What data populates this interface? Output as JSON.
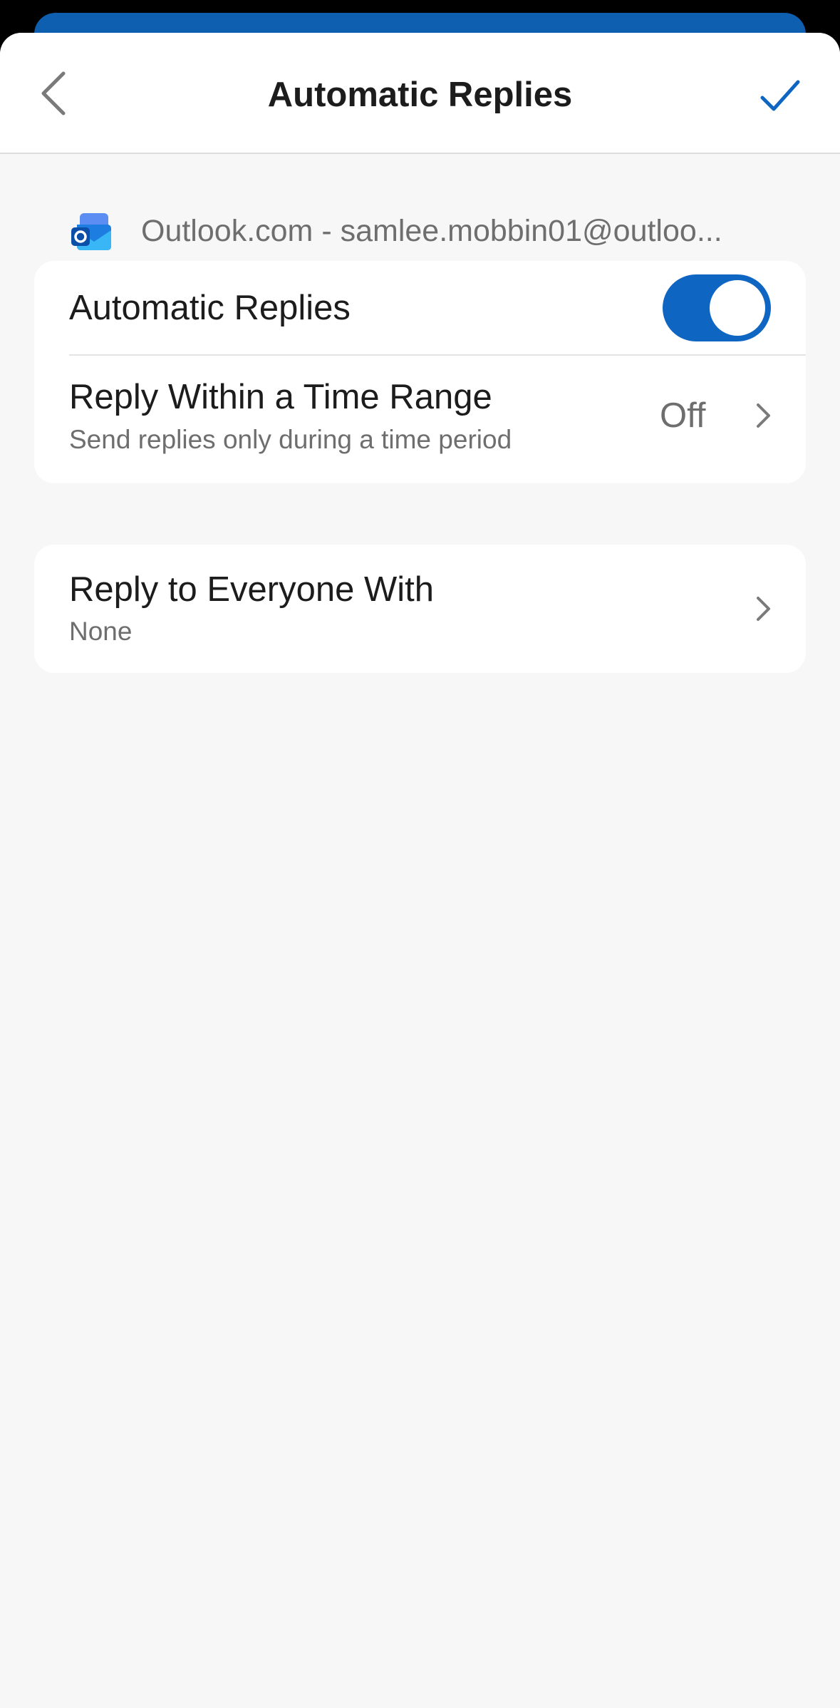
{
  "header": {
    "title": "Automatic Replies",
    "back_icon": "chevron-left-icon",
    "done_icon": "checkmark-icon"
  },
  "account": {
    "label": "Outlook.com - samlee.mobbin01@outloo...",
    "icon": "outlook-logo-icon"
  },
  "settings": {
    "automatic_replies": {
      "label": "Automatic Replies",
      "enabled": true
    },
    "time_range": {
      "title": "Reply Within a Time Range",
      "subtitle": "Send replies only during a time period",
      "value": "Off"
    },
    "reply_everyone": {
      "title": "Reply to Everyone With",
      "value": "None"
    }
  },
  "colors": {
    "accent": "#0f66c2",
    "sheet_top": "#0f5fb0",
    "background": "#f7f7f7",
    "secondary_text": "#6e6e6e"
  }
}
